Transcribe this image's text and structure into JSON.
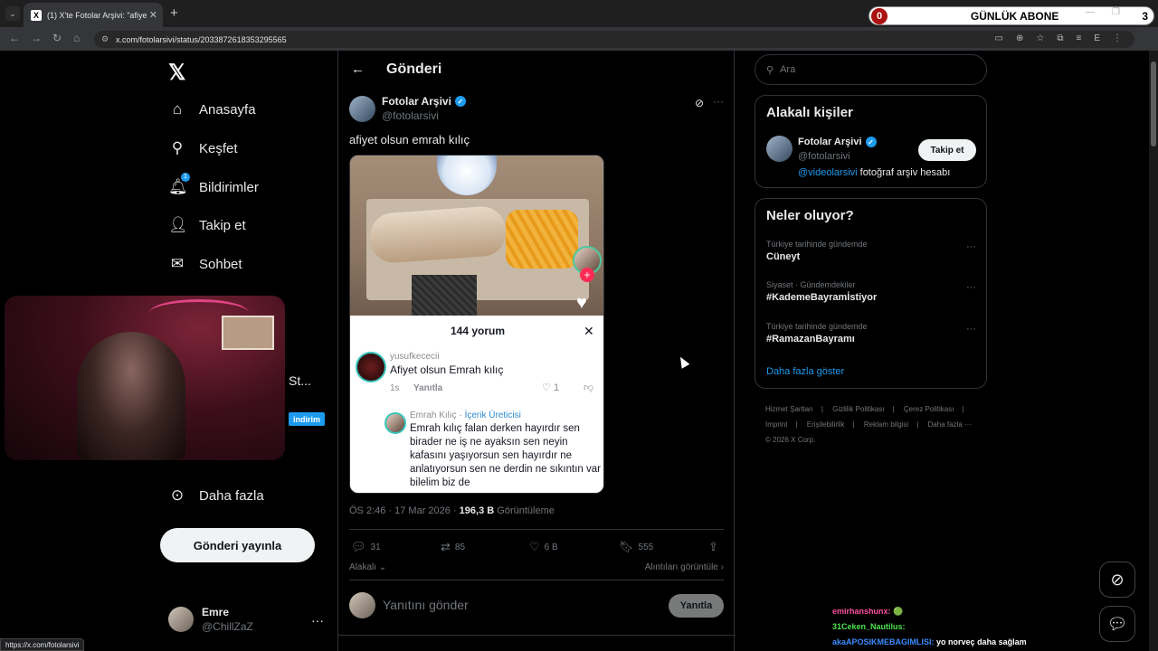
{
  "browser": {
    "tab_title": "(1) X'te Fotolar Arşivi: \"afiyet ol…",
    "url": "x.com/fotolarsivi/status/2033872618353295565",
    "status_url": "https://x.com/fotolarsivi",
    "overlay_title": "GÜNLÜK ABONE",
    "overlay_left": "0",
    "overlay_right": "3"
  },
  "nav": {
    "items": [
      {
        "label": "Anasayfa",
        "icon": "home-icon"
      },
      {
        "label": "Keşfet",
        "icon": "search-icon"
      },
      {
        "label": "Bildirimler",
        "icon": "bell-icon",
        "badge": "1"
      },
      {
        "label": "Takip et",
        "icon": "follow-icon"
      },
      {
        "label": "Sohbet",
        "icon": "mail-icon"
      },
      {
        "label": "Daha fazla",
        "icon": "more-circle-icon"
      }
    ],
    "post_button": "Gönderi yayınla",
    "user": {
      "name": "Emre",
      "handle": "@ChillZaZ"
    },
    "peek_text": "St...",
    "peek_badge": "indirim"
  },
  "header": {
    "title": "Gönderi"
  },
  "post": {
    "author_name": "Fotolar Arşivi",
    "author_handle": "@fotolarsivi",
    "text": "afiyet olsun emrah kılıç",
    "media": {
      "comment_count_title": "144 yorum",
      "comment1": {
        "user": "yusufkececii",
        "text": "Afiyet olsun Emrah kılıç",
        "time": "1s",
        "reply": "Yanıtla",
        "likes": "1"
      },
      "comment2": {
        "user": "Emrah Kılıç",
        "creator": "İçerik Üreticisi",
        "text": "Emrah kılıç falan derken hayırdır sen birader ne iş ne ayaksın sen neyin kafasını yaşıyorsun sen hayırdır ne anlatıyorsun sen ne derdin ne sıkıntın var bilelim biz de"
      }
    },
    "time": "ÖS 2:46 · 17 Mar 2026 · ",
    "views": "196,3 B",
    "views_label": "Görüntüleme",
    "stats": {
      "replies": "31",
      "reposts": "85",
      "likes": "6 B",
      "bookmarks": "555"
    },
    "sort_label": "Alakalı",
    "quotes_label": "Alıntıları görüntüle",
    "reply_placeholder": "Yanıtını gönder",
    "reply_button": "Yanıtla"
  },
  "sidebar": {
    "search_placeholder": "Ara",
    "relevant": {
      "title": "Alakalı kişiler",
      "name": "Fotolar Arşivi",
      "handle": "@fotolarsivi",
      "bio_link": "@videolarsivi",
      "bio_text": " fotoğraf arşiv hesabı",
      "follow": "Takip et"
    },
    "trends": {
      "title": "Neler oluyor?",
      "items": [
        {
          "category": "Türkiye tarihinde gündemde",
          "name": "Cüneyt"
        },
        {
          "category": "Siyaset · Gündemdekiler",
          "name": "#KademeBayramİstiyor"
        },
        {
          "category": "Türkiye tarihinde gündemde",
          "name": "#RamazanBayramı"
        }
      ],
      "show_more": "Daha fazla göster"
    },
    "footer": [
      "Hizmet Şartları",
      "Gizlilik Politikası",
      "Çerez Politikası",
      "Imprint",
      "Erişilebilirlik",
      "Reklam bilgisi",
      "Daha fazla ···",
      "© 2026 X Corp."
    ]
  },
  "chat": [
    {
      "user": "emirhanshunx:",
      "text": "🟢"
    },
    {
      "user": "31Ceken_Nautilus:",
      "text": ""
    },
    {
      "user": "akaAPOSIKMEBAGIMLISI:",
      "text": "yo norveç daha sağlam"
    }
  ]
}
